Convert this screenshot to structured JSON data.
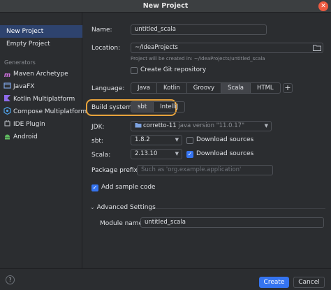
{
  "window": {
    "title": "New Project"
  },
  "sidebar": {
    "items": [
      {
        "label": "New Project"
      },
      {
        "label": "Empty Project"
      }
    ],
    "generators_header": "Generators",
    "generators": [
      {
        "label": "Maven Archetype",
        "icon": "maven-icon"
      },
      {
        "label": "JavaFX",
        "icon": "javafx-icon"
      },
      {
        "label": "Kotlin Multiplatform",
        "icon": "kotlin-icon"
      },
      {
        "label": "Compose Multiplatform",
        "icon": "compose-icon"
      },
      {
        "label": "IDE Plugin",
        "icon": "plugin-icon"
      },
      {
        "label": "Android",
        "icon": "android-icon"
      }
    ]
  },
  "form": {
    "name_label": "Name:",
    "name_value": "untitled_scala",
    "location_label": "Location:",
    "location_value": "~/IdeaProjects",
    "location_hint": "Project will be created in: ~/IdeaProjects/untitled_scala",
    "git_label": "Create Git repository",
    "language_label": "Language:",
    "languages": [
      "Java",
      "Kotlin",
      "Groovy",
      "Scala",
      "HTML"
    ],
    "language_selected": "Scala",
    "build_label": "Build system:",
    "build_options": [
      "sbt",
      "IntelliJ"
    ],
    "build_selected": "sbt",
    "jdk_label": "JDK:",
    "jdk_value": "corretto-11",
    "jdk_version": "java version \"11.0.17\"",
    "sbt_label": "sbt:",
    "sbt_value": "1.8.2",
    "sbt_download_label": "Download sources",
    "scala_label": "Scala:",
    "scala_value": "2.13.10",
    "scala_download_label": "Download sources",
    "scala_download_checked": true,
    "package_label": "Package prefix:",
    "package_placeholder": "Such as 'org.example.application'",
    "sample_label": "Add sample code",
    "sample_checked": true,
    "advanced_label": "Advanced Settings",
    "module_label": "Module name:",
    "module_value": "untitled_scala"
  },
  "footer": {
    "create_label": "Create",
    "cancel_label": "Cancel",
    "help_label": "?"
  },
  "colors": {
    "accent": "#3574f0",
    "selection": "#2e436e",
    "highlight": "#e8a33c",
    "close": "#ef5b41"
  }
}
